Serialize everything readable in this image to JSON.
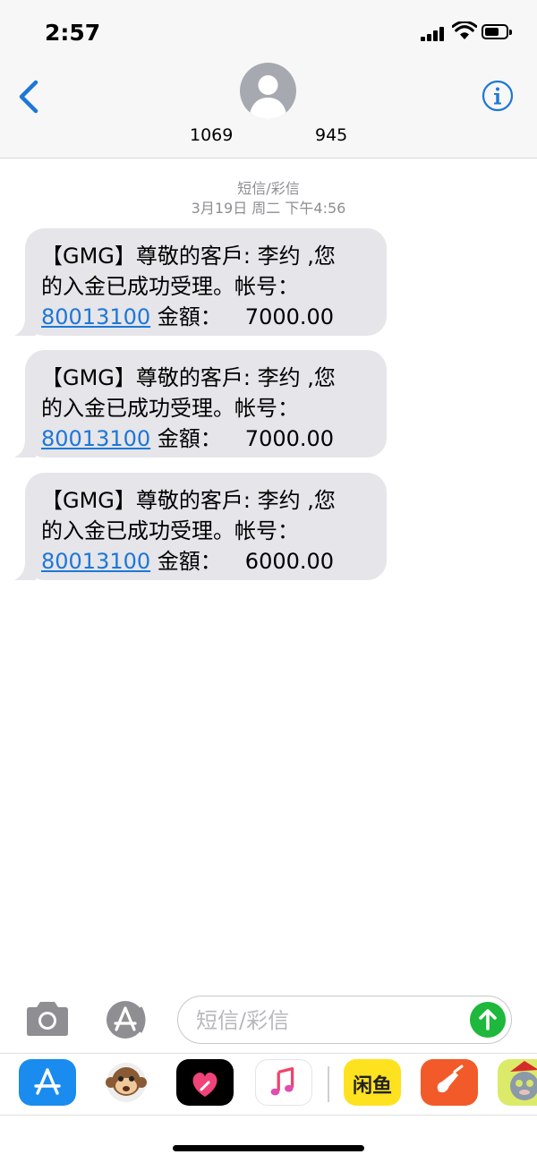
{
  "status_bar": {
    "time": "2:57"
  },
  "header": {
    "contact_left": "1069",
    "contact_right": "945"
  },
  "thread": {
    "service": "短信/彩信",
    "timestamp": "3月19日 周二 下午4:56"
  },
  "messages": [
    {
      "line1": "【GMG】尊敬的客戶: 李约 ,您",
      "line2": "的入金已成功受理。帐号：",
      "account": "80013100",
      "amount_label": " 金額：",
      "amount": "7000.00"
    },
    {
      "line1": "【GMG】尊敬的客戶: 李约 ,您",
      "line2": "的入金已成功受理。帐号：",
      "account": "80013100",
      "amount_label": " 金額：",
      "amount": "7000.00"
    },
    {
      "line1": "【GMG】尊敬的客戶: 李约 ,您",
      "line2": "的入金已成功受理。帐号：",
      "account": "80013100",
      "amount_label": " 金額：",
      "amount": "6000.00"
    }
  ],
  "composer": {
    "placeholder": "短信/彩信"
  },
  "app_drawer": {
    "apps": [
      "app-store-icon",
      "animoji-monkey-icon",
      "digital-touch-icon",
      "music-icon",
      "xianyu-app-icon",
      "garageband-icon",
      "talking-tom-icon"
    ],
    "xianyu_text": "闲鱼"
  },
  "colors": {
    "bubble": "#e5e5ea",
    "link": "#1d77d6",
    "send": "#1db83c",
    "accent": "#1d77d6"
  }
}
